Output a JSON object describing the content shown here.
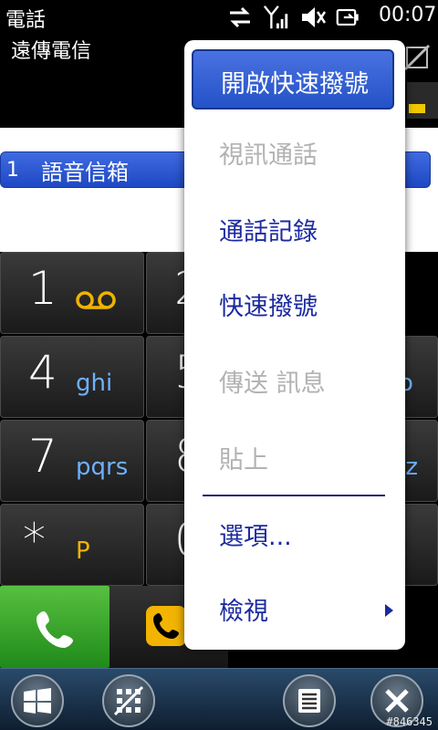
{
  "header": {
    "app_title": "電話",
    "carrier": "遠傳電信",
    "clock": "00:07"
  },
  "contact": {
    "index": "1",
    "name": "語音信箱"
  },
  "keypad": {
    "keys": [
      {
        "num": "1",
        "sub": "oo"
      },
      {
        "num": "2",
        "sub": ""
      },
      {
        "num": "4",
        "sub": "ghi"
      },
      {
        "num": "5",
        "sub": ""
      },
      {
        "num": "7",
        "sub": "pqrs"
      },
      {
        "num": "8",
        "sub": ""
      },
      {
        "num": "*",
        "sub": "P"
      },
      {
        "num": "0",
        "sub": ""
      }
    ],
    "partial_right": [
      "o",
      "yz"
    ]
  },
  "menu": {
    "items": [
      {
        "label": "開啟快速撥號",
        "enabled": true,
        "selected": true
      },
      {
        "label": "視訊通話",
        "enabled": false
      },
      {
        "label": "通話記錄",
        "enabled": true
      },
      {
        "label": "快速撥號",
        "enabled": true
      },
      {
        "label": "傳送 訊息",
        "enabled": false
      },
      {
        "label": "貼上",
        "enabled": false
      },
      {
        "label": "選項...",
        "enabled": true
      },
      {
        "label": "檢視",
        "enabled": true,
        "has_submenu": true
      }
    ]
  },
  "watermark": "#846345",
  "colors": {
    "accent_blue": "#2452c8",
    "menu_text": "#1c2aa0",
    "disabled_text": "#b2b2b2",
    "call_green": "#3aa82a",
    "key_letters": "#6fb0ff",
    "key_letters_yellow": "#f0b400"
  }
}
